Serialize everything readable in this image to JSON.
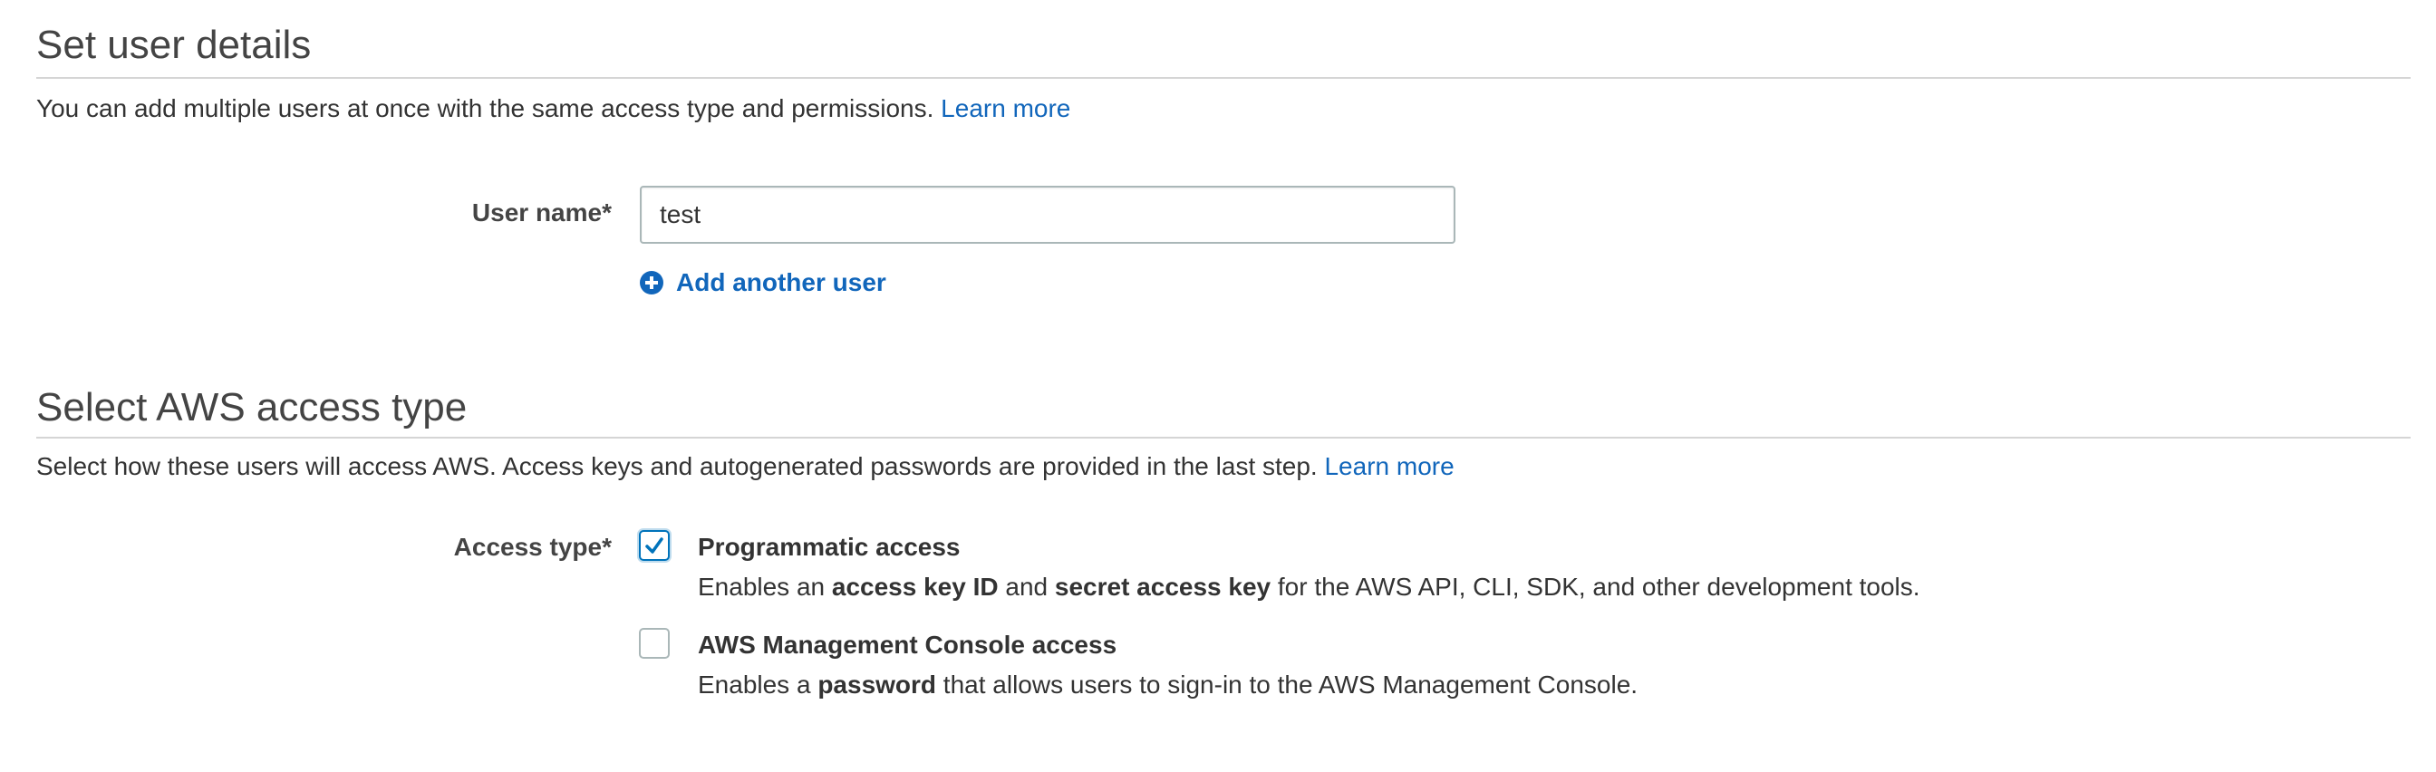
{
  "user_details": {
    "title": "Set user details",
    "description": "You can add multiple users at once with the same access type and permissions.",
    "learn_more": "Learn more",
    "user_name_label": "User name*",
    "user_name_value": "test",
    "add_another_user": "Add another user"
  },
  "access_type": {
    "title": "Select AWS access type",
    "description": "Select how these users will access AWS. Access keys and autogenerated passwords are provided in the last step.",
    "learn_more": "Learn more",
    "label": "Access type*",
    "options": [
      {
        "title": "Programmatic access",
        "checked": true,
        "desc_part1": "Enables an ",
        "desc_bold1": "access key ID",
        "desc_part2": " and ",
        "desc_bold2": "secret access key",
        "desc_part3": " for the AWS API, CLI, SDK, and other development tools."
      },
      {
        "title": "AWS Management Console access",
        "checked": false,
        "desc_part1": "Enables a ",
        "desc_bold1": "password",
        "desc_part2": " that allows users to sign-in to the AWS Management Console."
      }
    ]
  },
  "colors": {
    "link": "#1166bb",
    "checkbox_checked": "#0073bb",
    "text": "#333333"
  },
  "icons": {
    "add_user": "plus-circle-icon",
    "checkbox_checked": "checkmark-icon"
  }
}
